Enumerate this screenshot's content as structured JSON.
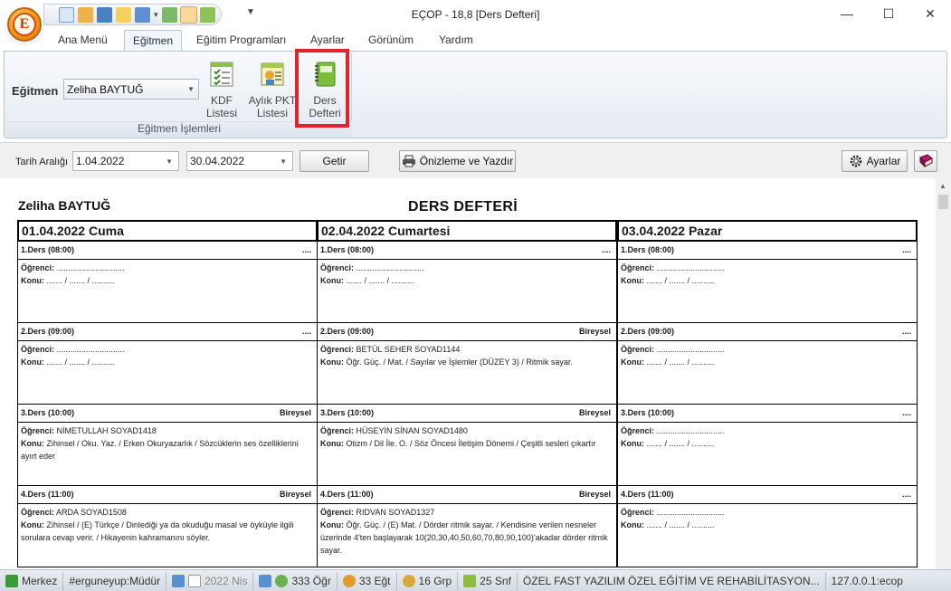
{
  "window": {
    "title": "EÇOP - 18,8 [Ders Defteri]",
    "app_logo_letter": "E",
    "controls": {
      "minimize": "—",
      "maximize": "☐",
      "close": "✕"
    }
  },
  "quick_access": {
    "more": "▼"
  },
  "menu": {
    "tabs": [
      "Ana Menü",
      "Eğitmen",
      "Eğitim Programları",
      "Ayarlar",
      "Görünüm",
      "Yardım"
    ],
    "active": "Eğitmen"
  },
  "ribbon": {
    "egitmen_label": "Eğitmen",
    "egitmen_value": "Zeliha BAYTUĞ",
    "buttons": [
      {
        "line1": "KDF",
        "line2": "Listesi"
      },
      {
        "line1": "Aylık PKT",
        "line2": "Listesi"
      },
      {
        "line1": "Ders",
        "line2": "Defteri"
      }
    ],
    "group_caption": "Eğitmen İşlemleri"
  },
  "filter": {
    "label": "Tarih Aralığı",
    "start": "1.04.2022",
    "end": "30.04.2022",
    "getir": "Getir",
    "print": "Önizleme ve Yazdır",
    "ayarlar": "Ayarlar"
  },
  "report": {
    "teacher": "Zeliha BAYTUĞ",
    "title": "DERS DEFTERİ",
    "labels": {
      "ogrenci": "Öğrenci:",
      "konu": "Konu:"
    },
    "days": [
      {
        "header": "01.04.2022 Cuma",
        "lessons": [
          {
            "title": "1.Ders (08:00)",
            "tag": "....",
            "ogrenci": " ..............................",
            "konu": " ....... / ....... / .........."
          },
          {
            "title": "2.Ders (09:00)",
            "tag": "....",
            "ogrenci": " ..............................",
            "konu": " ....... / ....... / .........."
          },
          {
            "title": "3.Ders (10:00)",
            "tag": "Bireysel",
            "ogrenci": " NİMETULLAH SOYAD1418",
            "konu": " Zihinsel / Oku. Yaz. / Erken Okuryazarlık / Sözcüklerin ses özelliklerini ayırt eder"
          },
          {
            "title": "4.Ders (11:00)",
            "tag": "Bireysel",
            "ogrenci": " ARDA SOYAD1508",
            "konu": " Zihinsel / (E) Türkçe / Dinlediği ya da okuduğu masal ve öyküyle ilgili sorulara cevap verir. / Hikayenin kahramanını söyler."
          }
        ]
      },
      {
        "header": "02.04.2022 Cumartesi",
        "lessons": [
          {
            "title": "1.Ders (08:00)",
            "tag": "....",
            "ogrenci": " ..............................",
            "konu": " ....... / ....... / .........."
          },
          {
            "title": "2.Ders (09:00)",
            "tag": "Bireysel",
            "ogrenci": " BETÜL SEHER SOYAD1144",
            "konu": " Öğr. Güç. / Mat. / Sayılar ve İşlemler (DÜZEY 3) / Ritmik sayar."
          },
          {
            "title": "3.Ders (10:00)",
            "tag": "Bireysel",
            "ogrenci": " HÜSEYİN SİNAN SOYAD1480",
            "konu": " Otizm / Dil İle. O. / Söz Öncesi İletişim Dönemi / Çeşitli sesleri çıkartır"
          },
          {
            "title": "4.Ders (11:00)",
            "tag": "Bireysel",
            "ogrenci": " RIDVAN SOYAD1327",
            "konu": " Öğr. Güç. / (E) Mat. / Dörder ritmik sayar. / Kendisine verilen nesneler üzerinde 4'ten başlayarak 10(20,30,40,50,60,70,80,90,100)'akadar dörder ritmik sayar."
          }
        ]
      },
      {
        "header": "03.04.2022 Pazar",
        "lessons": [
          {
            "title": "1.Ders (08:00)",
            "tag": "....",
            "ogrenci": " ..............................",
            "konu": " ....... / ....... / .........."
          },
          {
            "title": "2.Ders (09:00)",
            "tag": "....",
            "ogrenci": " ..............................",
            "konu": " ....... / ....... / .........."
          },
          {
            "title": "3.Ders (10:00)",
            "tag": "....",
            "ogrenci": " ..............................",
            "konu": " ....... / ....... / .........."
          },
          {
            "title": "4.Ders (11:00)",
            "tag": "....",
            "ogrenci": " ..............................",
            "konu": " ....... / ....... / .........."
          }
        ]
      }
    ]
  },
  "statusbar": {
    "branch": "Merkez",
    "user": "#erguneyup:Müdür",
    "month": "2022 Nis",
    "ogr": "333 Öğr",
    "egt": "33 Eğt",
    "grp": "16 Grp",
    "snf": "25 Snf",
    "org": "ÖZEL FAST YAZILIM ÖZEL EĞİTİM VE REHABİLİTASYON...",
    "server": "127.0.0.1:ecop"
  }
}
